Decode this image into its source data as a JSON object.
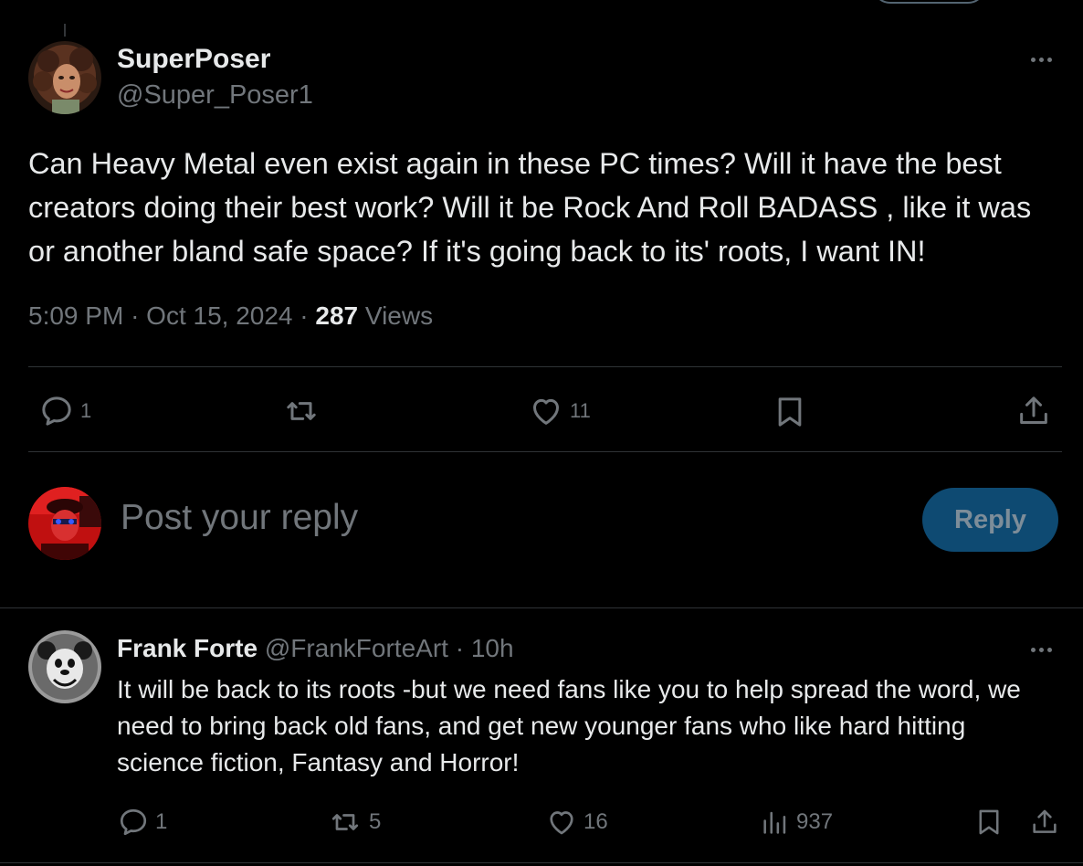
{
  "tweet": {
    "author_name": "SuperPoser",
    "author_handle": "@Super_Poser1",
    "text": "Can Heavy Metal even exist again in these PC times? Will it have the best creators doing their best work? Will it be Rock And Roll BADASS , like it was or another bland safe space? If it's going back to its' roots, I want IN!",
    "time": "5:09 PM",
    "date": "Oct 15, 2024",
    "separator": "·",
    "views_count": "287",
    "views_label": "Views",
    "actions": {
      "reply_count": "1",
      "retweet_count": "",
      "like_count": "11",
      "bookmark_icon": "bookmark-icon",
      "share_icon": "share-icon"
    }
  },
  "composer": {
    "placeholder": "Post your reply",
    "button_label": "Reply"
  },
  "reply": {
    "author_name": "Frank Forte",
    "author_handle": "@FrankForteArt",
    "separator": "·",
    "time_ago": "10h",
    "text": "It will be back to its roots -but we need fans like you to help spread the word, we need to bring back old fans, and get new younger fans who like hard hitting science fiction, Fantasy and Horror!",
    "actions": {
      "reply_count": "1",
      "retweet_count": "5",
      "like_count": "16",
      "views_count": "937"
    }
  },
  "colors": {
    "background": "#000000",
    "text": "#e7e9ea",
    "secondary": "#71767b",
    "divider": "#2f3336",
    "reply_button_bg": "#0e4a72"
  }
}
